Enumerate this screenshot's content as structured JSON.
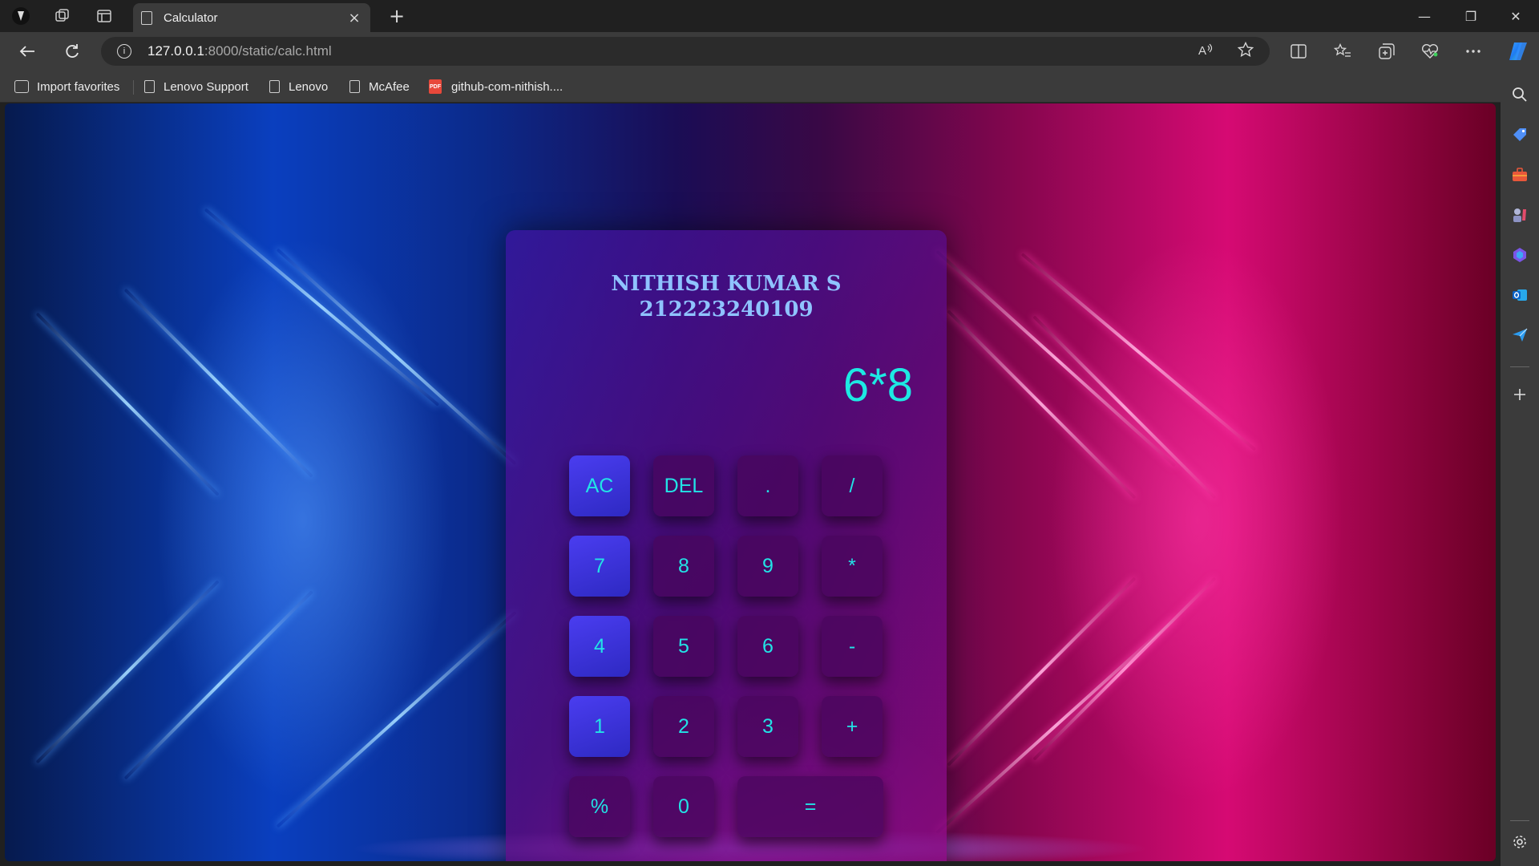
{
  "browser": {
    "tab": {
      "title": "Calculator",
      "close": "×"
    },
    "new_tab": "+",
    "window_controls": {
      "minimize": "—",
      "restore": "❐",
      "close": "✕"
    },
    "address": {
      "host": "127.0.0.1",
      "path": ":8000/static/calc.html",
      "info": "i"
    },
    "favorites": [
      {
        "label": "Import favorites",
        "icon": "import-icon"
      },
      {
        "label": "Lenovo Support",
        "icon": "page-icon"
      },
      {
        "label": "Lenovo",
        "icon": "page-icon"
      },
      {
        "label": "McAfee",
        "icon": "page-icon"
      },
      {
        "label": "github-com-nithish....",
        "icon": "pdf-icon"
      }
    ],
    "sidebar": [
      "search-icon",
      "shopping-tag-icon",
      "tools-icon",
      "games-icon",
      "copilot-icon",
      "outlook-icon",
      "send-icon",
      "add-icon",
      "settings-icon"
    ]
  },
  "calculator": {
    "name": "NITHISH KUMAR S",
    "id": "212223240109",
    "display": "6*8",
    "keys": {
      "ac": "AC",
      "del": "DEL",
      "dot": ".",
      "divide": "/",
      "seven": "7",
      "eight": "8",
      "nine": "9",
      "multiply": "*",
      "four": "4",
      "five": "5",
      "six": "6",
      "minus": "-",
      "one": "1",
      "two": "2",
      "three": "3",
      "plus": "+",
      "percent": "%",
      "zero": "0",
      "equals": "="
    }
  }
}
